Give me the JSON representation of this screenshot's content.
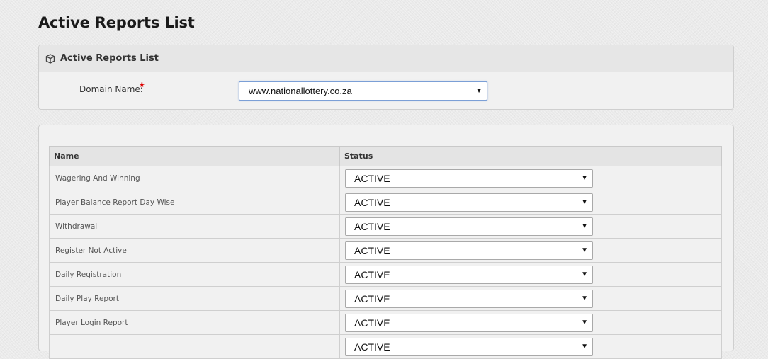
{
  "page": {
    "title": "Active Reports List"
  },
  "filter_panel": {
    "heading": "Active Reports List",
    "heading_icon": "cube-icon",
    "domain_label": "Domain Name:",
    "required_marker": "*",
    "domain_value": "www.nationallottery.co.za",
    "dropdown_arrow": "▼"
  },
  "reports_table": {
    "columns": [
      "Name",
      "Status"
    ],
    "rows": [
      {
        "name": "Wagering And Winning",
        "status": "ACTIVE"
      },
      {
        "name": "Player Balance Report Day Wise",
        "status": "ACTIVE"
      },
      {
        "name": "Withdrawal",
        "status": "ACTIVE"
      },
      {
        "name": "Register Not Active",
        "status": "ACTIVE"
      },
      {
        "name": "Daily Registration",
        "status": "ACTIVE"
      },
      {
        "name": "Daily Play Report",
        "status": "ACTIVE"
      },
      {
        "name": "Player Login Report",
        "status": "ACTIVE"
      },
      {
        "name": "",
        "status": "ACTIVE"
      }
    ]
  },
  "colors": {
    "required": "#dd0000",
    "focus_border": "#7b9fd6"
  }
}
